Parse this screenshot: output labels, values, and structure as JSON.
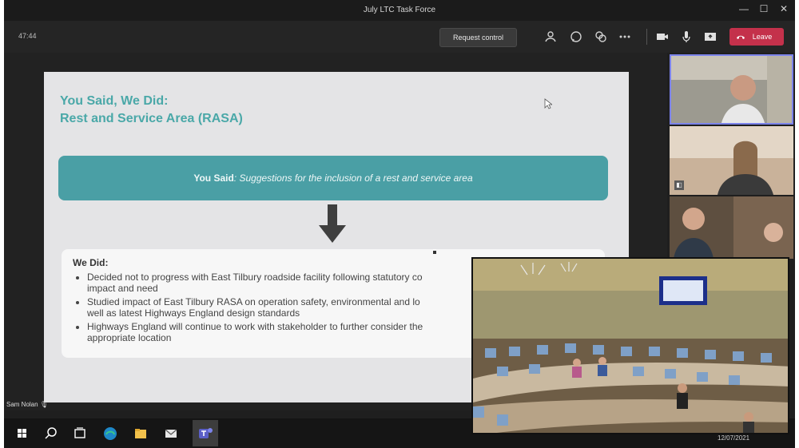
{
  "window": {
    "title": "July LTC Task Force",
    "controls": [
      "—",
      "☐",
      "✕"
    ]
  },
  "toolbar": {
    "timer": "47:44",
    "request_control_label": "Request control",
    "icons": [
      "participants-icon",
      "chat-icon",
      "reactions-icon",
      "more-icon",
      "camera-icon",
      "mic-icon",
      "share-icon"
    ],
    "leave_label": "Leave",
    "leave_color": "#c4314b"
  },
  "slide": {
    "title_line1": "You Said, We Did:",
    "title_line2": "Rest and Service Area (RASA)",
    "you_said_label": "You Said",
    "you_said_text": ": Suggestions for the inclusion of a rest and service area",
    "we_did_label": "We Did:",
    "we_did_items": [
      "Decided not to progress with East Tilbury roadside facility following statutory co",
      "impact and need",
      "Studied impact of East Tilbury RASA on operation safety, environmental and lo",
      "well as latest Highways England design standards",
      "Highways England will continue to work with stakeholder to further consider the",
      "appropriate location"
    ],
    "accent_color": "#4aa8a8",
    "box_color": "#4a9fa5"
  },
  "presenter": {
    "name": "Sam Nolan"
  },
  "taskbar": {
    "icons": [
      "windows-start-icon",
      "search-icon",
      "task-view-icon",
      "edge-icon",
      "file-explorer-icon",
      "mail-icon",
      "teams-icon"
    ],
    "date": "12/07/2021"
  }
}
